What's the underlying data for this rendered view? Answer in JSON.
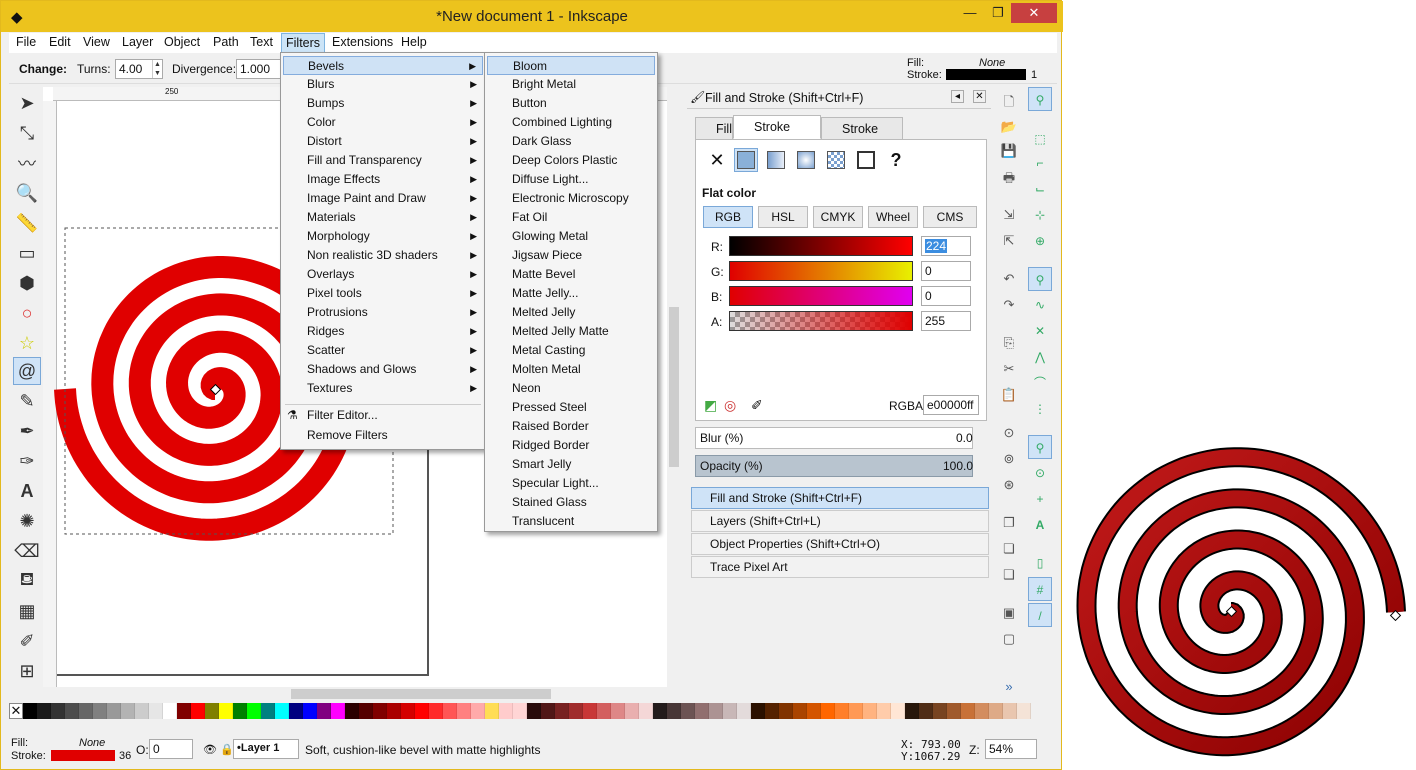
{
  "window": {
    "title": "*New document 1 - Inkscape"
  },
  "menubar": [
    "File",
    "Edit",
    "View",
    "Layer",
    "Object",
    "Path",
    "Text",
    "Filters",
    "Extensions",
    "Help"
  ],
  "toolbar": {
    "change_label": "Change:",
    "turns_label": "Turns:",
    "turns_value": "4.00",
    "divergence_label": "Divergence:",
    "divergence_value": "1.000"
  },
  "style_indicator": {
    "fill_label": "Fill:",
    "fill_value": "None",
    "stroke_label": "Stroke:",
    "stroke_width": "1"
  },
  "ruler": {
    "mark": "250"
  },
  "filters_menu": {
    "items": [
      "Bevels",
      "Blurs",
      "Bumps",
      "Color",
      "Distort",
      "Fill and Transparency",
      "Image Effects",
      "Image Paint and Draw",
      "Materials",
      "Morphology",
      "Non realistic 3D shaders",
      "Overlays",
      "Pixel tools",
      "Protrusions",
      "Ridges",
      "Scatter",
      "Shadows and Glows",
      "Textures"
    ],
    "filter_editor": "Filter Editor...",
    "remove_filters": "Remove Filters"
  },
  "bevels_menu": [
    "Bloom",
    "Bright Metal",
    "Button",
    "Combined Lighting",
    "Dark Glass",
    "Deep Colors Plastic",
    "Diffuse Light...",
    "Electronic Microscopy",
    "Fat Oil",
    "Glowing Metal",
    "Jigsaw Piece",
    "Matte Bevel",
    "Matte Jelly...",
    "Melted Jelly",
    "Melted Jelly Matte",
    "Metal Casting",
    "Molten Metal",
    "Neon",
    "Pressed Steel",
    "Raised Border",
    "Ridged Border",
    "Smart Jelly",
    "Specular Light...",
    "Stained Glass",
    "Translucent"
  ],
  "fill_stroke": {
    "title": "Fill and Stroke (Shift+Ctrl+F)",
    "tabs": [
      "Fill",
      "Stroke paint",
      "Stroke style"
    ],
    "flat_color": "Flat color",
    "modes": [
      "RGB",
      "HSL",
      "CMYK",
      "Wheel",
      "CMS"
    ],
    "channels": [
      {
        "label": "R:",
        "value": "224"
      },
      {
        "label": "G:",
        "value": "0"
      },
      {
        "label": "B:",
        "value": "0"
      },
      {
        "label": "A:",
        "value": "255"
      }
    ],
    "rgba_label": "RGBA:",
    "rgba_value": "e00000ff",
    "blur_label": "Blur (%)",
    "blur_value": "0.0",
    "opacity_label": "Opacity (%)",
    "opacity_value": "100.0"
  },
  "dock_panels": [
    "Fill and Stroke (Shift+Ctrl+F)",
    "Layers (Shift+Ctrl+L)",
    "Object Properties (Shift+Ctrl+O)",
    "Trace Pixel Art"
  ],
  "statusbar": {
    "fill_label": "Fill:",
    "fill_value": "None",
    "stroke_label": "Stroke:",
    "stroke_width": "36",
    "opacity_label": "O:",
    "opacity_value": "0",
    "layer": "•Layer 1",
    "message": "Soft, cushion-like bevel with matte highlights",
    "x_label": "X:",
    "x_value": "793.00",
    "y_label": "Y:",
    "y_value": "1067.29",
    "z_label": "Z:",
    "zoom": "54%"
  },
  "colors": {
    "accent": "#ecc31d",
    "stroke_red": "#e00000",
    "preview_red": "#a80000"
  }
}
